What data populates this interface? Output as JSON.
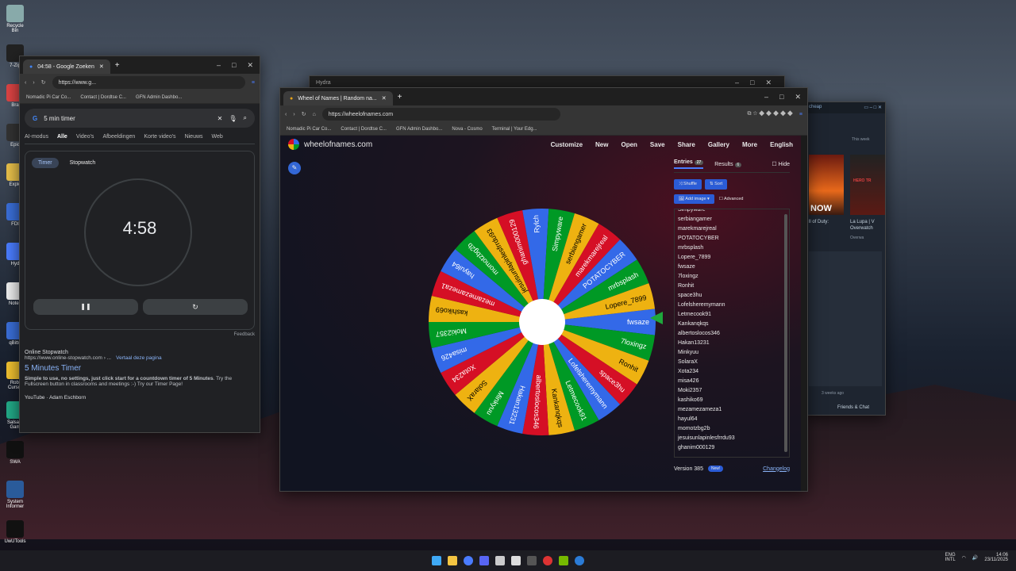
{
  "desktop": {
    "icons": [
      "Recycle Bin",
      "7-Zip",
      "Bra",
      "Epic",
      "Explo",
      "FDI",
      "Hyd",
      "Notep",
      "qBitto",
      "Robl Cursor",
      "SalsaM Gam",
      "SWA",
      "System Informer",
      "UwUTools"
    ]
  },
  "google": {
    "tab": "04:58 - Google Zoeken",
    "url": "https://www.g...",
    "bookmarks": [
      "Nomadic Pi Car Co...",
      "Contact | Dordtse C...",
      "GFN Admin Dashbo..."
    ],
    "query": "5 min timer",
    "filters": [
      "AI-modus",
      "Alle",
      "Video's",
      "Afbeeldingen",
      "Korte video's",
      "Nieuws",
      "Web"
    ],
    "mode_timer": "Timer",
    "mode_stopwatch": "Stopwatch",
    "time": "4:58",
    "feedback": "Feedback",
    "result_site": "Online Stopwatch",
    "result_url": "https://www.online-stopwatch.com › ...",
    "result_translate": "Vertaal deze pagina",
    "result_title": "5 Minutes Timer",
    "result_snippet_bold": "Simple to use, no settings, just click start for a countdown timer of 5 Minutes",
    "result_snippet": ". Try the Fullscreen button in classrooms and meetings :-) Try our Timer Page!",
    "next_result": "YouTube · Adam Eschborn"
  },
  "hydra": {
    "title": "Hydra"
  },
  "wheel": {
    "tab": "Wheel of Names | Random na...",
    "url": "https://wheelofnames.com",
    "bookmarks": [
      "Nomadic Pi Car Co...",
      "Contact | Dordtse C...",
      "GFN Admin Dashbo...",
      "Nova - Cosmo",
      "Terminal | Your Edg..."
    ],
    "brand": "wheelofnames.com",
    "menu": [
      "Customize",
      "New",
      "Open",
      "Save",
      "Share",
      "Gallery",
      "More",
      "English"
    ],
    "entries_tab": "Entries",
    "entries_count": "27",
    "results_tab": "Results",
    "results_count": "6",
    "hide": "Hide",
    "shuffle": "Shuffle",
    "sort": "Sort",
    "add_image": "Add image",
    "advanced": "Advanced",
    "entries": [
      "Simpyware",
      "serbiangamer",
      "marekmarejreal",
      "POTATOCYBER",
      "mrbsplash",
      "Lopere_7899",
      "fwsaze",
      "7loxingz",
      "Ronhit",
      "space3hu",
      "Lofelsheremymann",
      "Letmecook91",
      "Kankanqkqs",
      "albertoslocos346",
      "Hakan13231",
      "Minkyuu",
      "SolaraX",
      "Xota234",
      "misa426",
      "Moki2357",
      "kashiko69",
      "mezamezameza1",
      "hayul64",
      "momotzbg2b",
      "jesuisunlapinlesfrrdu93",
      "ghanim000129"
    ],
    "wheel_labels": [
      "fwsaze",
      "7loxingz",
      "Ronhit",
      "space3hu",
      "Lofelsheremymann",
      "Letmecook91",
      "Kankanqkqs",
      "albertoslocos346",
      "Hakan13231",
      "Minkyuu",
      "SolaraX",
      "Xota234",
      "misa426",
      "Moki2357",
      "kashiko69",
      "mezamezameza1",
      "hayul64",
      "momotzbg2b",
      "jesuisunlapinlesfrrdu93",
      "ghanim000129",
      "Rylch",
      "Simpyware",
      "serbiangamer",
      "marekmarejreal",
      "POTATOCYBER",
      "mrbsplash",
      "Lopere_7899"
    ],
    "version": "Version 385",
    "new_badge": "New!",
    "changelog": "Changelog",
    "colors": [
      "#3369e8",
      "#009925",
      "#eeb211",
      "#d50f25"
    ]
  },
  "steam": {
    "tag": "cheap",
    "cap1": "ll of Duty:",
    "cap2": "La Lupa | V",
    "cap3": "Overwatch",
    "caption_right": "Overwa",
    "ago": "3 weeks ago",
    "friends": "Friends & Chat",
    "banner": "NOW",
    "this_week": "This week",
    "game_logo": "HERO TR"
  },
  "tray": {
    "lang1": "ENG",
    "lang2": "INTL",
    "time": "14:06",
    "date": "23/11/2025"
  }
}
